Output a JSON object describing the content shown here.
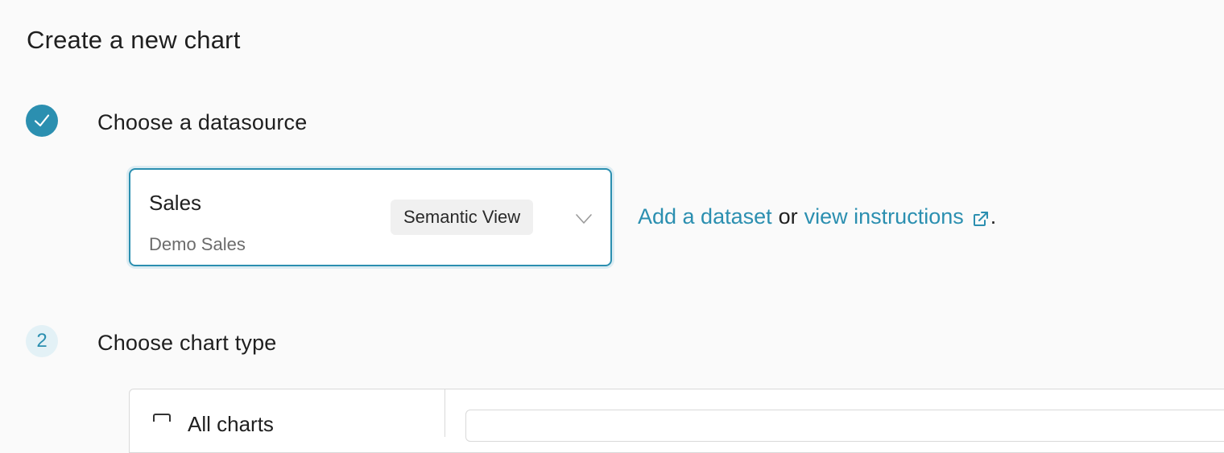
{
  "page": {
    "title": "Create a new chart"
  },
  "steps": [
    {
      "indicator_icon": "check-icon",
      "label": "Choose a datasource"
    },
    {
      "number": "2",
      "label": "Choose chart type"
    }
  ],
  "datasource": {
    "selected_name": "Sales",
    "selected_database": "Demo Sales",
    "badge": "Semantic View",
    "dropdown_icon": "chevron-down-icon"
  },
  "helper": {
    "add_dataset_link": "Add a dataset",
    "or_text": "or",
    "instructions_link": "view instructions",
    "trailing": ".",
    "external_icon": "external-link-icon"
  },
  "chart_type": {
    "category_label": "All charts",
    "category_icon": "folder-icon",
    "search_placeholder": ""
  },
  "colors": {
    "accent": "#2b8fb0",
    "accent_light": "#e3f1f6",
    "text": "#1f1f1f",
    "muted_text": "#6b6b6b",
    "badge_bg": "#f0f0f0"
  }
}
